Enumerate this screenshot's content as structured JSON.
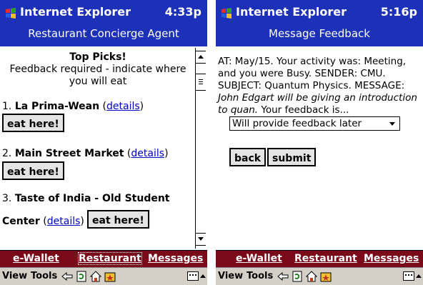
{
  "left": {
    "titlebar": {
      "app": "Internet Explorer",
      "time": "4:33p",
      "subtitle": "Restaurant Concierge Agent"
    },
    "content": {
      "heading": "Top Picks!",
      "instruction_line1": "Feedback required - indicate where",
      "instruction_line2": "you will eat",
      "details_label": "details",
      "eat_here_label": "eat here!",
      "restaurants": [
        {
          "num": "1.",
          "name": "La Prima-Wean"
        },
        {
          "num": "2.",
          "name": "Main Street Market"
        },
        {
          "num": "3.",
          "name": "Taste of India - Old Student",
          "name_cont": "Center"
        }
      ]
    },
    "tabs": [
      "e-Wallet",
      "Restaurant",
      "Messages"
    ],
    "toolbar": {
      "view": "View",
      "tools": "Tools"
    }
  },
  "right": {
    "titlebar": {
      "app": "Internet Explorer",
      "time": "5:16p",
      "subtitle": "Message Feedback"
    },
    "content": {
      "message_part1": "AT: May/15. Your activity was: Meeting, and you were Busy. SENDER: CMU. SUBJECT: Quantum Physics. MESSAGE: ",
      "message_italic": "John Edgart will be giving an introduction to quan.",
      "message_part2": " Your feedback is...",
      "select_value": "Will provide feedback later",
      "back_label": "back",
      "submit_label": "submit"
    },
    "tabs": [
      "e-Wallet",
      "Restaurant",
      "Messages"
    ],
    "toolbar": {
      "view": "View",
      "tools": "Tools"
    }
  },
  "colors": {
    "titlebar": "#1c31b8",
    "tabbar": "#7a0a1a",
    "toolbar": "#d4d0c8",
    "link": "#0000cc"
  }
}
